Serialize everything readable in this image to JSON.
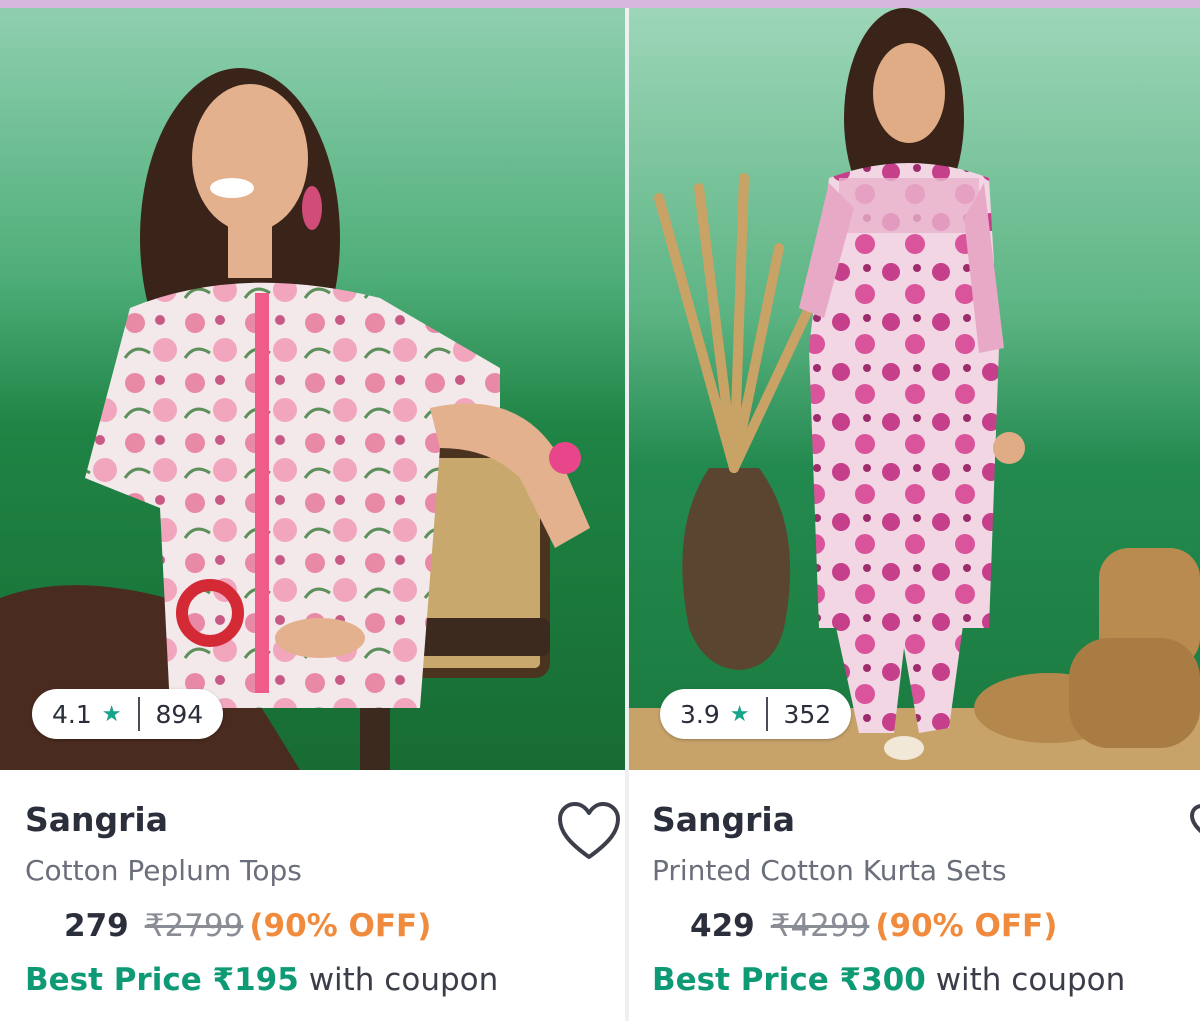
{
  "products": [
    {
      "rating": "4.1",
      "rating_count": "894",
      "brand": "Sangria",
      "name": "Cotton Peplum Tops",
      "price": "279",
      "mrp": "₹2799",
      "discount": "(90% OFF)",
      "best_price": "Best Price ₹195",
      "coupon_text": "with coupon"
    },
    {
      "rating": "3.9",
      "rating_count": "352",
      "brand": "Sangria",
      "name": "Printed Cotton Kurta Sets",
      "price": "429",
      "mrp": "₹4299",
      "discount": "(90% OFF)",
      "best_price": "Best Price ₹300",
      "coupon_text": "with coupon"
    }
  ],
  "icons": {
    "star": "star-icon",
    "wishlist": "heart-icon"
  },
  "colors": {
    "accent_green": "#0f9a76",
    "discount_orange": "#f08a3c",
    "rating_star": "#19a38a",
    "top_strip": "#d6b7dd"
  }
}
